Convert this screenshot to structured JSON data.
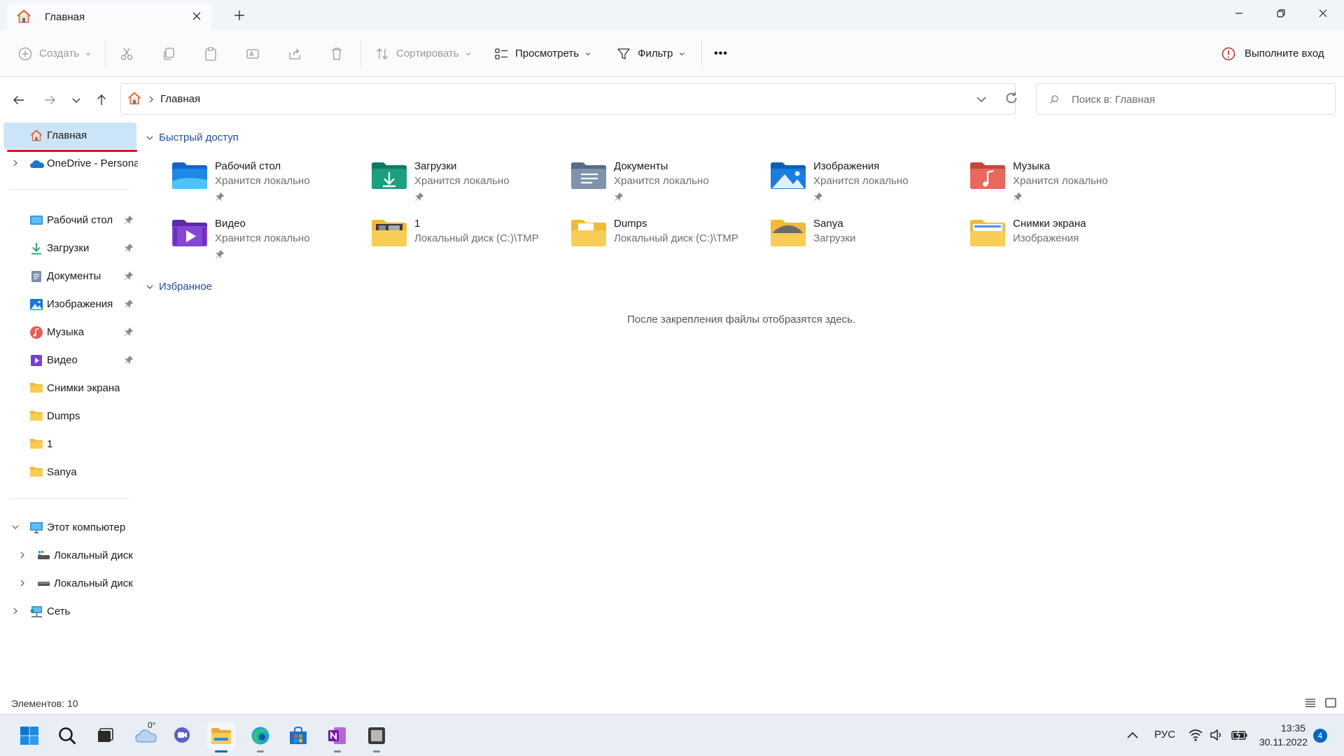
{
  "window": {
    "tab_title": "Главная",
    "new_tab_glyph": "+"
  },
  "toolbar": {
    "create": "Создать",
    "sort": "Сортировать",
    "view": "Просмотреть",
    "filter": "Фильтр",
    "more": "•••",
    "signin": "Выполните вход"
  },
  "address": {
    "crumb": "Главная",
    "search_placeholder": "Поиск в: Главная"
  },
  "sidebar": {
    "home": "Главная",
    "onedrive": "OneDrive - Persona",
    "pinned": [
      {
        "label": "Рабочий стол",
        "icon": "desktop-icon"
      },
      {
        "label": "Загрузки",
        "icon": "downloads-icon"
      },
      {
        "label": "Документы",
        "icon": "documents-icon"
      },
      {
        "label": "Изображения",
        "icon": "pictures-icon"
      },
      {
        "label": "Музыка",
        "icon": "music-icon"
      },
      {
        "label": "Видео",
        "icon": "videos-icon"
      },
      {
        "label": "Снимки экрана",
        "icon": "folder-icon"
      },
      {
        "label": "Dumps",
        "icon": "folder-icon"
      },
      {
        "label": "1",
        "icon": "folder-icon"
      },
      {
        "label": "Sanya",
        "icon": "folder-icon"
      }
    ],
    "this_pc": "Этот компьютер",
    "disk1": "Локальный диск",
    "disk2": "Локальный диск",
    "network": "Сеть"
  },
  "main": {
    "quick_access_header": "Быстрый доступ",
    "favorites_header": "Избранное",
    "favorites_empty": "После закрепления файлы отобразятся здесь.",
    "quick_items": [
      {
        "name": "Рабочий стол",
        "sub": "Хранится локально",
        "pinned": true,
        "icon": "desktop-folder-icon"
      },
      {
        "name": "Загрузки",
        "sub": "Хранится локально",
        "pinned": true,
        "icon": "downloads-folder-icon"
      },
      {
        "name": "Документы",
        "sub": "Хранится локально",
        "pinned": true,
        "icon": "documents-folder-icon"
      },
      {
        "name": "Изображения",
        "sub": "Хранится локально",
        "pinned": true,
        "icon": "pictures-folder-icon"
      },
      {
        "name": "Музыка",
        "sub": "Хранится локально",
        "pinned": true,
        "icon": "music-folder-icon"
      },
      {
        "name": "Видео",
        "sub": "Хранится локально",
        "pinned": true,
        "icon": "videos-folder-icon"
      },
      {
        "name": "1",
        "sub": "Локальный диск (C:)\\TMP",
        "pinned": false,
        "icon": "folder-icon"
      },
      {
        "name": "Dumps",
        "sub": "Локальный диск (C:)\\TMP",
        "pinned": false,
        "icon": "folder-icon"
      },
      {
        "name": "Sanya",
        "sub": "Загрузки",
        "pinned": false,
        "icon": "folder-icon"
      },
      {
        "name": "Снимки экрана",
        "sub": "Изображения",
        "pinned": false,
        "icon": "folder-icon"
      }
    ]
  },
  "status": {
    "items_count": "Элементов: 10"
  },
  "taskbar": {
    "weather_temp": "0°",
    "language": "РУС",
    "time": "13:35",
    "date": "30.11.2022",
    "notifications": "4"
  },
  "colors": {
    "accent": "#0067c0",
    "selection": "#cce4f7",
    "header_blue": "#1f4ea1",
    "folder_yellow": "#f8cd55",
    "annotation_red": "#e0002a"
  }
}
